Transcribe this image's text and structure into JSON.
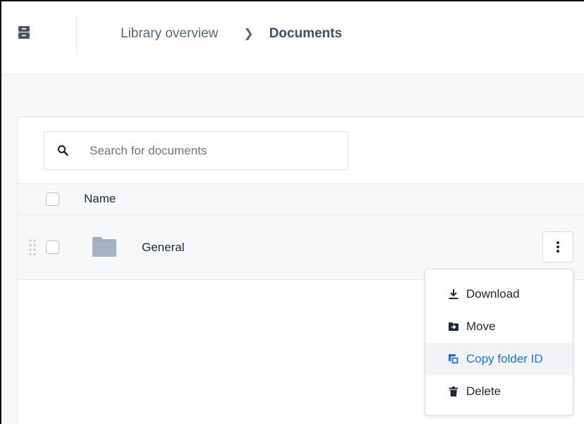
{
  "header": {
    "app_icon": "archive-box-icon",
    "breadcrumb": {
      "parent": "Library overview",
      "separator": "chevron-right-icon",
      "current": "Documents"
    }
  },
  "search": {
    "icon": "search-icon",
    "placeholder": "Search for documents",
    "value": ""
  },
  "table": {
    "columns": [
      "Name"
    ],
    "rows": [
      {
        "name": "General",
        "icon": "folder-icon"
      }
    ]
  },
  "context_menu": {
    "items": [
      {
        "label": "Download",
        "icon": "download-icon"
      },
      {
        "label": "Move",
        "icon": "move-icon"
      },
      {
        "label": "Copy folder ID",
        "icon": "copy-icon",
        "highlighted": true
      },
      {
        "label": "Delete",
        "icon": "trash-icon"
      }
    ]
  },
  "colors": {
    "accent": "#1a73d9",
    "breadcrumb_text": "#56687a",
    "folder": "#a3adbb"
  }
}
